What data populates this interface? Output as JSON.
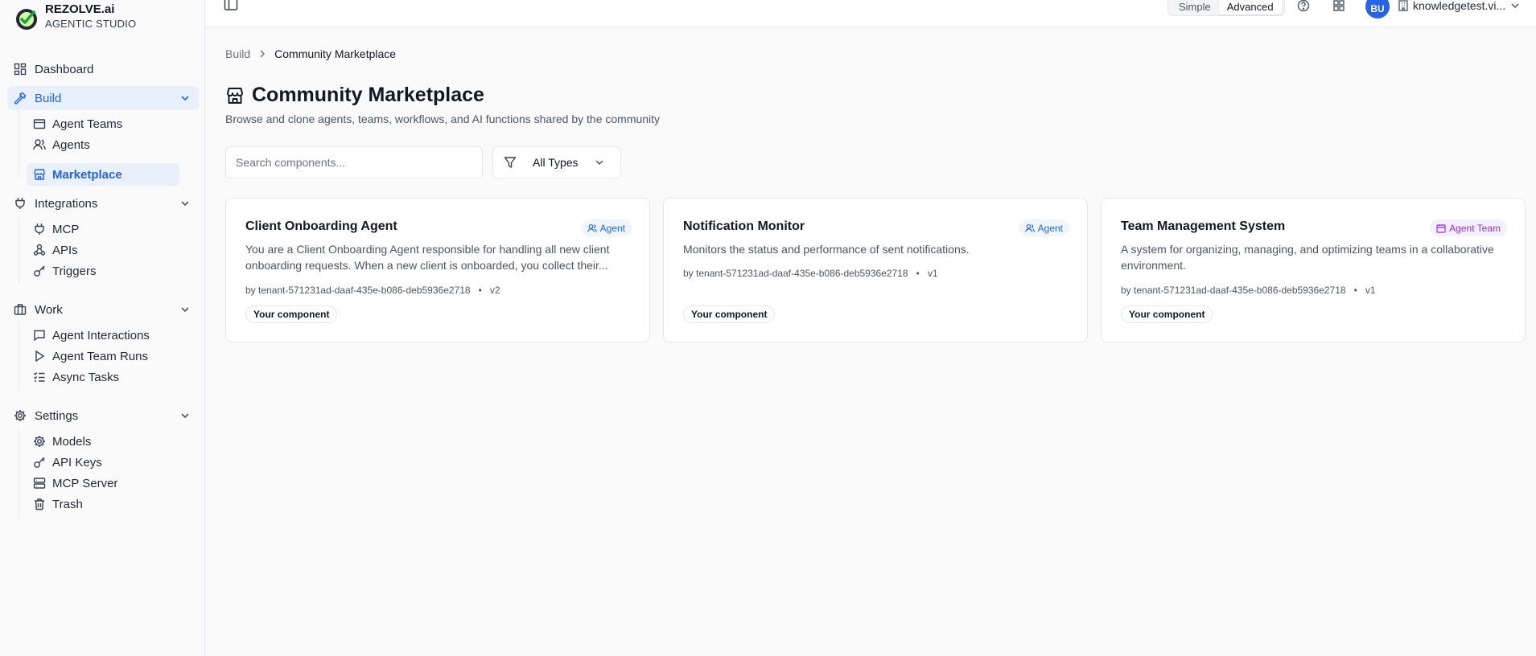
{
  "brand": {
    "name": "REZOLVE.ai",
    "subtitle": "AGENTIC STUDIO"
  },
  "sidebar": {
    "dashboard": "Dashboard",
    "build": {
      "label": "Build",
      "items": [
        "Agent Teams",
        "Agents",
        "Marketplace"
      ]
    },
    "integrations": {
      "label": "Integrations",
      "items": [
        "MCP",
        "APIs",
        "Triggers"
      ]
    },
    "work": {
      "label": "Work",
      "items": [
        "Agent Interactions",
        "Agent Team Runs",
        "Async Tasks"
      ]
    },
    "settings": {
      "label": "Settings",
      "items": [
        "Models",
        "API Keys",
        "MCP Server",
        "Trash"
      ]
    }
  },
  "topbar": {
    "mode_simple": "Simple",
    "mode_advanced": "Advanced",
    "active_mode": "Advanced",
    "avatar": "BU",
    "tenant": "knowledgetest.vi..."
  },
  "breadcrumb": {
    "parent": "Build",
    "current": "Community Marketplace"
  },
  "page": {
    "title": "Community Marketplace",
    "subtitle": "Browse and clone agents, teams, workflows, and AI functions shared by the community"
  },
  "search": {
    "placeholder": "Search components...",
    "value": ""
  },
  "filter": {
    "selected": "All Types"
  },
  "cards": [
    {
      "title": "Client Onboarding Agent",
      "badge": "Agent",
      "description": "You are a Client Onboarding Agent responsible for handling all new client onboarding requests. When a new client is onboarded, you collect their...",
      "author": "by tenant-571231ad-daaf-435e-b086-deb5936e2718",
      "version": "v2",
      "tag": "Your component"
    },
    {
      "title": "Notification Monitor",
      "badge": "Agent",
      "description": "Monitors the status and performance of sent notifications.",
      "author": "by tenant-571231ad-daaf-435e-b086-deb5936e2718",
      "version": "v1",
      "tag": "Your component"
    },
    {
      "title": "Team Management System",
      "badge": "Agent Team",
      "description": "A system for organizing, managing, and optimizing teams in a collaborative environment.",
      "author": "by tenant-571231ad-daaf-435e-b086-deb5936e2718",
      "version": "v1",
      "tag": "Your component"
    }
  ],
  "colors": {
    "accent": "#2563eb",
    "accent_bg": "#e8f0fb",
    "team_badge": "#9333ea"
  }
}
